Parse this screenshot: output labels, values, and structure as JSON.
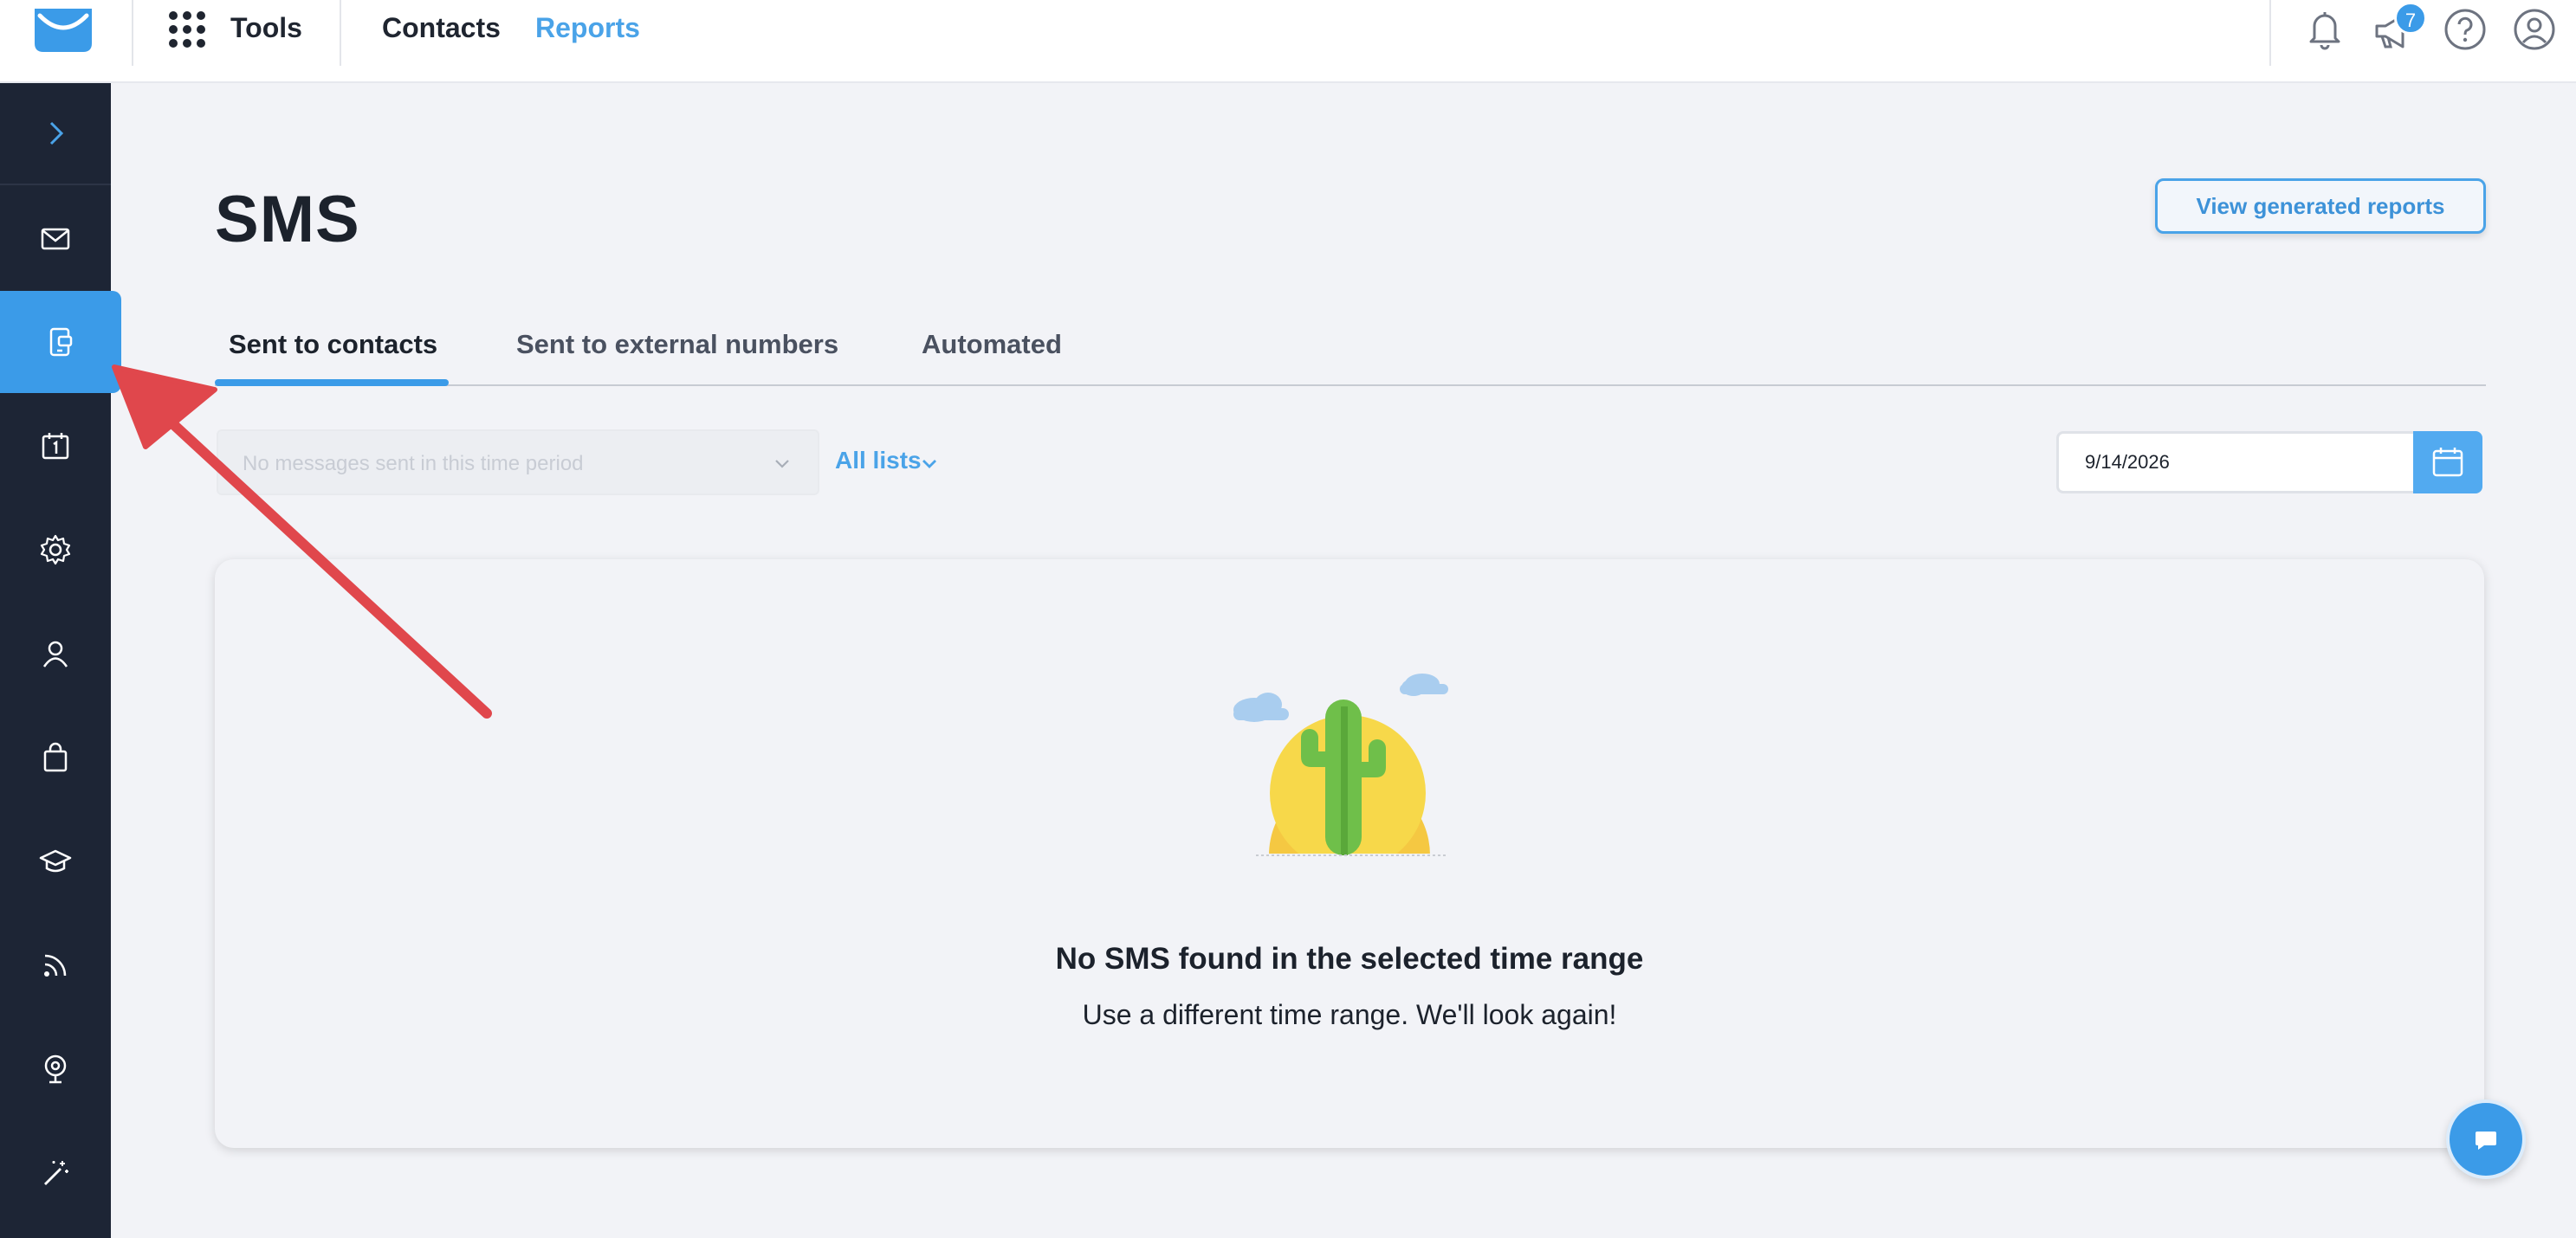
{
  "header": {
    "tools_label": "Tools",
    "nav": [
      "Contacts",
      "Reports"
    ],
    "notification_badge": "7",
    "icons": [
      "logo-envelope-icon",
      "apps-grid-icon",
      "bell-icon",
      "megaphone-icon",
      "help-icon",
      "user-profile-icon"
    ]
  },
  "sidebar": {
    "items": [
      {
        "icon": "chevron-right-icon"
      },
      {
        "icon": "envelope-icon"
      },
      {
        "icon": "sms-device-icon",
        "active": true
      },
      {
        "icon": "calendar-icon"
      },
      {
        "icon": "gear-icon"
      },
      {
        "icon": "person-icon"
      },
      {
        "icon": "shopping-bag-icon"
      },
      {
        "icon": "graduation-cap-icon"
      },
      {
        "icon": "rss-feed-icon"
      },
      {
        "icon": "webcam-icon"
      },
      {
        "icon": "magic-wand-icon"
      }
    ]
  },
  "page": {
    "title": "SMS",
    "view_reports_button": "View generated reports",
    "tabs": [
      "Sent to contacts",
      "Sent to external numbers",
      "Automated"
    ],
    "active_tab": "Sent to contacts",
    "message_select_placeholder": "No messages sent in this time period",
    "lists_filter": "All lists",
    "date_value": "9/14/2026",
    "empty_title": "No SMS found in the selected time range",
    "empty_subtitle": "Use a different time range. We'll look again!"
  },
  "colors": {
    "accent": "#3b9be8",
    "sidebar_bg": "#1d2535",
    "annotation_arrow": "#e0474c"
  }
}
